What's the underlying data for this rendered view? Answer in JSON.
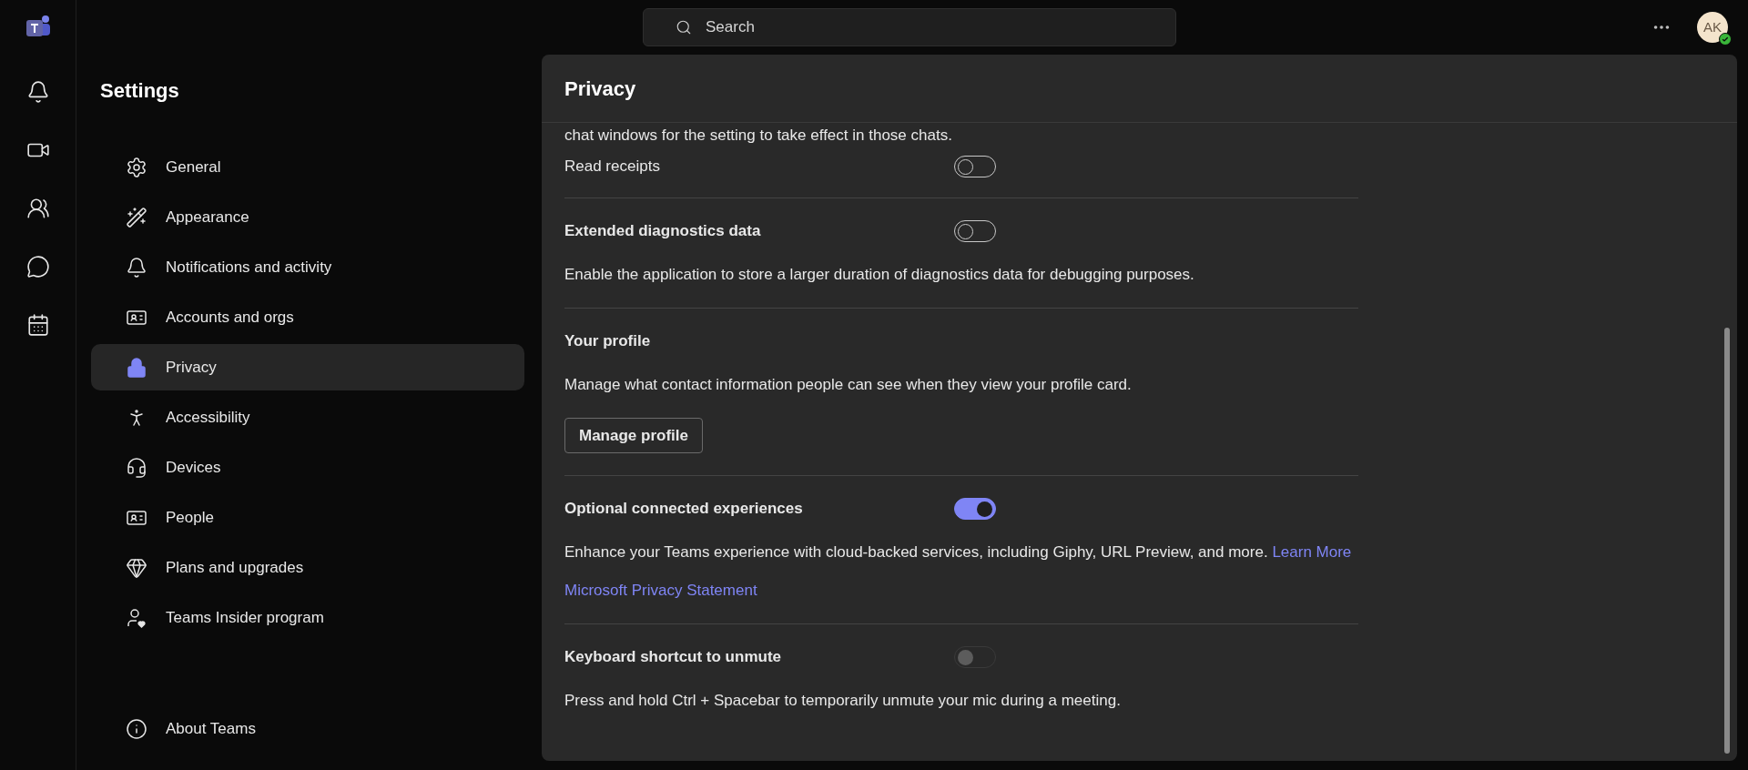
{
  "top_bar": {
    "search": {
      "placeholder": "Search"
    },
    "avatar": {
      "initials": "AK"
    }
  },
  "sidebar": {
    "title": "Settings",
    "items": [
      {
        "label": "General",
        "selected": false
      },
      {
        "label": "Appearance",
        "selected": false
      },
      {
        "label": "Notifications and activity",
        "selected": false
      },
      {
        "label": "Accounts and orgs",
        "selected": false
      },
      {
        "label": "Privacy",
        "selected": true
      },
      {
        "label": "Accessibility",
        "selected": false
      },
      {
        "label": "Devices",
        "selected": false
      },
      {
        "label": "People",
        "selected": false
      },
      {
        "label": "Plans and upgrades",
        "selected": false
      },
      {
        "label": "Teams Insider program",
        "selected": false
      }
    ],
    "footer_item": {
      "label": "About Teams"
    }
  },
  "panel": {
    "title": "Privacy",
    "lead_text": "chat windows for the setting to take effect in those chats.",
    "sections": [
      {
        "kind": "toggle",
        "title": "Read receipts",
        "strong": false,
        "on": false,
        "disabled": false
      },
      {
        "kind": "toggle",
        "title": "Extended diagnostics data",
        "strong": true,
        "on": false,
        "disabled": false,
        "description": "Enable the application to store a larger duration of diagnostics data for debugging purposes."
      },
      {
        "kind": "button",
        "title": "Your profile",
        "strong": true,
        "description": "Manage what contact information people can see when they view your profile card.",
        "button": "Manage profile"
      },
      {
        "kind": "toggle",
        "title": "Optional connected experiences",
        "strong": true,
        "on": true,
        "disabled": false,
        "description": "Enhance your Teams experience with cloud-backed services, including Giphy, URL Preview, and more.",
        "inline_link": "Learn More",
        "link": "Microsoft Privacy Statement"
      },
      {
        "kind": "toggle",
        "title": "Keyboard shortcut to unmute",
        "strong": true,
        "on": false,
        "disabled": true,
        "description": "Press and hold Ctrl + Spacebar to temporarily unmute your mic during a meeting."
      }
    ]
  }
}
